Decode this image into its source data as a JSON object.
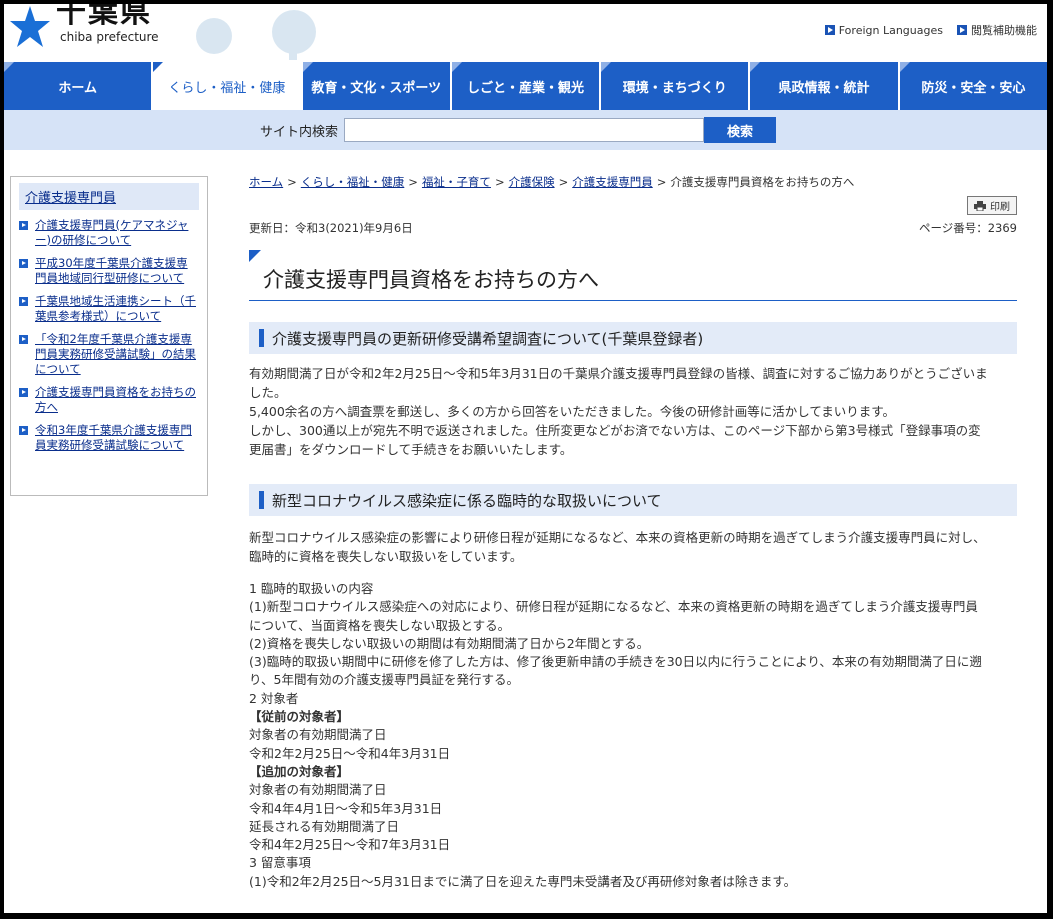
{
  "header": {
    "logo_title": "千葉県",
    "logo_sub": "chiba prefecture",
    "utility": [
      {
        "label": "Foreign Languages"
      },
      {
        "label": "閲覧補助機能"
      }
    ]
  },
  "nav": [
    {
      "label": "ホーム"
    },
    {
      "label": "くらし・福祉・健康"
    },
    {
      "label": "教育・文化・スポーツ"
    },
    {
      "label": "しごと・産業・観光"
    },
    {
      "label": "環境・まちづくり"
    },
    {
      "label": "県政情報・統計"
    },
    {
      "label": "防災・安全・安心"
    }
  ],
  "search": {
    "label": "サイト内検索",
    "value": "",
    "button": "検索"
  },
  "sidebar": {
    "heading": "介護支援専門員",
    "items": [
      {
        "label": "介護支援専門員(ケアマネジャー)の研修について"
      },
      {
        "label": "平成30年度千葉県介護支援専門員地域同行型研修について"
      },
      {
        "label": "千葉県地域生活連携シート（千葉県参考様式）について"
      },
      {
        "label": "「令和2年度千葉県介護支援専門員実務研修受講試験」の結果について"
      },
      {
        "label": "介護支援専門員資格をお持ちの方へ"
      },
      {
        "label": "令和3年度千葉県介護支援専門員実務研修受講試験について"
      }
    ]
  },
  "breadcrumb": {
    "links": [
      "ホーム",
      "くらし・福祉・健康",
      "福祉・子育て",
      "介護保険",
      "介護支援専門員"
    ],
    "current": "介護支援専門員資格をお持ちの方へ",
    "sep": ">"
  },
  "print": {
    "label": "印刷"
  },
  "meta": {
    "updated": "更新日：令和3(2021)年9月6日",
    "page_no": "ページ番号：2369"
  },
  "page_title": "介護支援専門員資格をお持ちの方へ",
  "section1": {
    "heading": "介護支援専門員の更新研修受講希望調査について(千葉県登録者)",
    "lines": [
      "有効期間満了日が令和2年2月25日～令和5年3月31日の千葉県介護支援専門員登録の皆様、調査に対するご協力ありがとうございま",
      "した。",
      "5,400余名の方へ調査票を郵送し、多くの方から回答をいただきました。今後の研修計画等に活かしてまいります。",
      "しかし、300通以上が宛先不明で返送されました。住所変更などがお済でない方は、このページ下部から第3号様式「登録事項の変",
      "更届書」をダウンロードして手続きをお願いいたします。"
    ]
  },
  "section2": {
    "heading": "新型コロナウイルス感染症に係る臨時的な取扱いについて",
    "intro": [
      "新型コロナウイルス感染症の影響により研修日程が延期になるなど、本来の資格更新の時期を過ぎてしまう介護支援専門員に対し、",
      "臨時的に資格を喪失しない取扱いをしています。"
    ],
    "l01": "1 臨時的取扱いの内容",
    "l02": " (1)新型コロナウイルス感染症への対応により、研修日程が延期になるなど、本来の資格更新の時期を過ぎてしまう介護支援専門員",
    "l03": "について、当面資格を喪失しない取扱とする。",
    "l04": " (2)資格を喪失しない取扱いの期間は有効期間満了日から2年間とする。",
    "l05": " (3)臨時的取扱い期間中に研修を修了した方は、修了後更新申請の手続きを30日以内に行うことにより、本来の有効期間満了日に遡",
    "l06": "り、5年間有効の介護支援専門員証を発行する。",
    "l07": "2 対象者",
    "l08": "【従前の対象者】",
    "l09": "対象者の有効期間満了日",
    "l10": "令和2年2月25日～令和4年3月31日",
    "l11": "【追加の対象者】",
    "l12": "対象者の有効期間満了日",
    "l13": "令和4年4月1日～令和5年3月31日",
    "l14": "延長される有効期間満了日",
    "l15": "令和4年2月25日～令和7年3月31日",
    "l16": "3 留意事項",
    "l17": " (1)令和2年2月25日～5月31日までに満了日を迎えた専門未受講者及び再研修対象者は除きます。"
  },
  "colors": {
    "brand_blue": "#1d5fc6",
    "search_bg": "#d6e3f7",
    "section_bg": "#e3ebf8"
  }
}
